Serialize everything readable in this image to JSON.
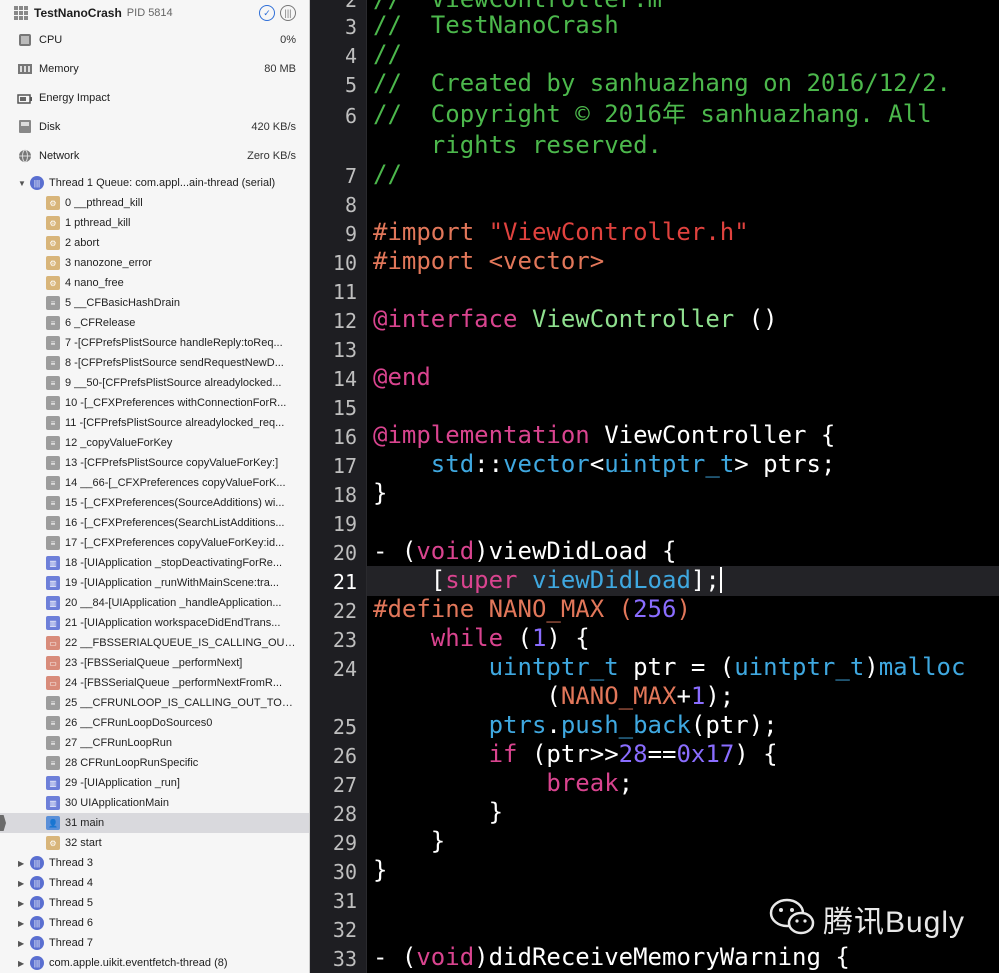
{
  "navigator": {
    "process": {
      "name": "TestNanoCrash",
      "pid": "PID 5814"
    },
    "gauges": [
      {
        "label": "CPU",
        "value": "0%",
        "icon": "cpu-icon"
      },
      {
        "label": "Memory",
        "value": "80 MB",
        "icon": "memory-icon"
      },
      {
        "label": "Energy Impact",
        "value": "",
        "icon": "energy-icon"
      },
      {
        "label": "Disk",
        "value": "420 KB/s",
        "icon": "disk-icon"
      },
      {
        "label": "Network",
        "value": "Zero KB/s",
        "icon": "network-icon"
      }
    ],
    "thread1": {
      "label": "Thread 1 Queue: com.appl...ain-thread (serial)"
    },
    "frames": [
      {
        "label": "0 __pthread_kill",
        "icon": "gear"
      },
      {
        "label": "1 pthread_kill",
        "icon": "gear"
      },
      {
        "label": "2 abort",
        "icon": "gear"
      },
      {
        "label": "3 nanozone_error",
        "icon": "gear"
      },
      {
        "label": "4 nano_free",
        "icon": "gear"
      },
      {
        "label": "5 __CFBasicHashDrain",
        "icon": "doc"
      },
      {
        "label": "6 _CFRelease",
        "icon": "doc"
      },
      {
        "label": "7 -[CFPrefsPlistSource handleReply:toReq...",
        "icon": "doc"
      },
      {
        "label": "8 -[CFPrefsPlistSource sendRequestNewD...",
        "icon": "doc"
      },
      {
        "label": "9 __50-[CFPrefsPlistSource alreadylocked...",
        "icon": "doc"
      },
      {
        "label": "10 -[_CFXPreferences withConnectionForR...",
        "icon": "doc"
      },
      {
        "label": "11 -[CFPrefsPlistSource alreadylocked_req...",
        "icon": "doc"
      },
      {
        "label": "12 _copyValueForKey",
        "icon": "doc"
      },
      {
        "label": "13 -[CFPrefsPlistSource copyValueForKey:]",
        "icon": "doc"
      },
      {
        "label": "14 __66-[_CFXPreferences copyValueForK...",
        "icon": "doc"
      },
      {
        "label": "15 -[_CFXPreferences(SourceAdditions) wi...",
        "icon": "doc"
      },
      {
        "label": "16 -[_CFXPreferences(SearchListAdditions...",
        "icon": "doc"
      },
      {
        "label": "17 -[_CFXPreferences copyValueForKey:id...",
        "icon": "doc"
      },
      {
        "label": "18 -[UIApplication _stopDeactivatingForRe...",
        "icon": "blue"
      },
      {
        "label": "19 -[UIApplication _runWithMainScene:tra...",
        "icon": "blue"
      },
      {
        "label": "20 __84-[UIApplication _handleApplication...",
        "icon": "blue"
      },
      {
        "label": "21 -[UIApplication workspaceDidEndTrans...",
        "icon": "blue"
      },
      {
        "label": "22 __FBSSERIALQUEUE_IS_CALLING_OUT_...",
        "icon": "window"
      },
      {
        "label": "23 -[FBSSerialQueue _performNext]",
        "icon": "window"
      },
      {
        "label": "24 -[FBSSerialQueue _performNextFromR...",
        "icon": "window"
      },
      {
        "label": "25 __CFRUNLOOP_IS_CALLING_OUT_TO_A...",
        "icon": "doc"
      },
      {
        "label": "26 __CFRunLoopDoSources0",
        "icon": "doc"
      },
      {
        "label": "27 __CFRunLoopRun",
        "icon": "doc"
      },
      {
        "label": "28 CFRunLoopRunSpecific",
        "icon": "doc"
      },
      {
        "label": "29 -[UIApplication _run]",
        "icon": "blue"
      },
      {
        "label": "30 UIApplicationMain",
        "icon": "blue"
      },
      {
        "label": "31 main",
        "icon": "user",
        "selected": true
      },
      {
        "label": "32 start",
        "icon": "gear"
      }
    ],
    "threads": [
      "Thread 3",
      "Thread 4",
      "Thread 5",
      "Thread 6",
      "Thread 7",
      "com.apple.uikit.eventfetch-thread (8)"
    ]
  },
  "editor": {
    "current_line": "21",
    "line_numbers": [
      "2",
      "3",
      "4",
      "5",
      "6",
      "7",
      "8",
      "9",
      "10",
      "11",
      "12",
      "13",
      "14",
      "15",
      "16",
      "17",
      "18",
      "19",
      "20",
      "21",
      "22",
      "23",
      "24",
      "25",
      "26",
      "27",
      "28",
      "29",
      "30",
      "31",
      "32",
      "33"
    ],
    "code": {
      "l2": "//  ViewController.m",
      "l3": "//  TestNanoCrash",
      "l4": "//",
      "l5": "//  Created by sanhuazhang on 2016/12/2.",
      "l6a": "//  Copyright © 2016年 sanhuazhang. All",
      "l6b": "    rights reserved.",
      "l7": "//",
      "l9_pp": "#import ",
      "l9_str": "\"ViewController.h\"",
      "l10_pp": "#import <vector>",
      "l12_kw": "@interface ",
      "l12_cl": "ViewController",
      "l12_rest": " ()",
      "l14": "@end",
      "l16_kw": "@implementation ",
      "l16_rest": "ViewController {",
      "l17_a": "    ",
      "l17_std": "std",
      "l17_b": "::",
      "l17_vec": "vector",
      "l17_c": "<",
      "l17_ty": "uintptr_t",
      "l17_d": "> ptrs;",
      "l18": "}",
      "l20_a": "- (",
      "l20_kw": "void",
      "l20_b": ")viewDidLoad {",
      "l21_a": "    [",
      "l21_kw": "super",
      "l21_b": " ",
      "l21_m": "viewDidLoad",
      "l21_c": "];",
      "l22_pp": "#define ",
      "l22_mac": "NANO_MAX",
      "l22_b": " (",
      "l22_num": "256",
      "l22_c": ")",
      "l23_a": "    ",
      "l23_kw": "while",
      "l23_b": " (",
      "l23_num": "1",
      "l23_c": ") {",
      "l24_a": "        ",
      "l24_ty": "uintptr_t",
      "l24_b": " ptr = (",
      "l24_ty2": "uintptr_t",
      "l24_c": ")",
      "l24_fn": "malloc",
      "l24w_a": "            (",
      "l24w_mac": "NANO_MAX",
      "l24w_b": "+",
      "l24w_num": "1",
      "l24w_c": ");",
      "l25_a": "        ",
      "l25_m": "ptrs",
      "l25_b": ".",
      "l25_fn": "push_back",
      "l25_c": "(ptr);",
      "l26_a": "        ",
      "l26_kw": "if",
      "l26_b": " (ptr>>",
      "l26_n1": "28",
      "l26_c": "==",
      "l26_n2": "0x17",
      "l26_d": ") {",
      "l27_a": "            ",
      "l27_kw": "break",
      "l27_b": ";",
      "l28": "        }",
      "l29": "    }",
      "l30": "}",
      "l33_a": "- (",
      "l33_kw": "void",
      "l33_b": ")didReceiveMemoryWarning {"
    }
  },
  "watermark": {
    "text": "腾讯Bugly",
    "icon": "wechat-icon"
  },
  "colors": {
    "comment": "#4cb84c",
    "preprocessor": "#e2775a",
    "string": "#e0423e",
    "keyword": "#d9448f",
    "type": "#3fa8e0",
    "class": "#8fe08f",
    "number": "#8a6dff"
  }
}
